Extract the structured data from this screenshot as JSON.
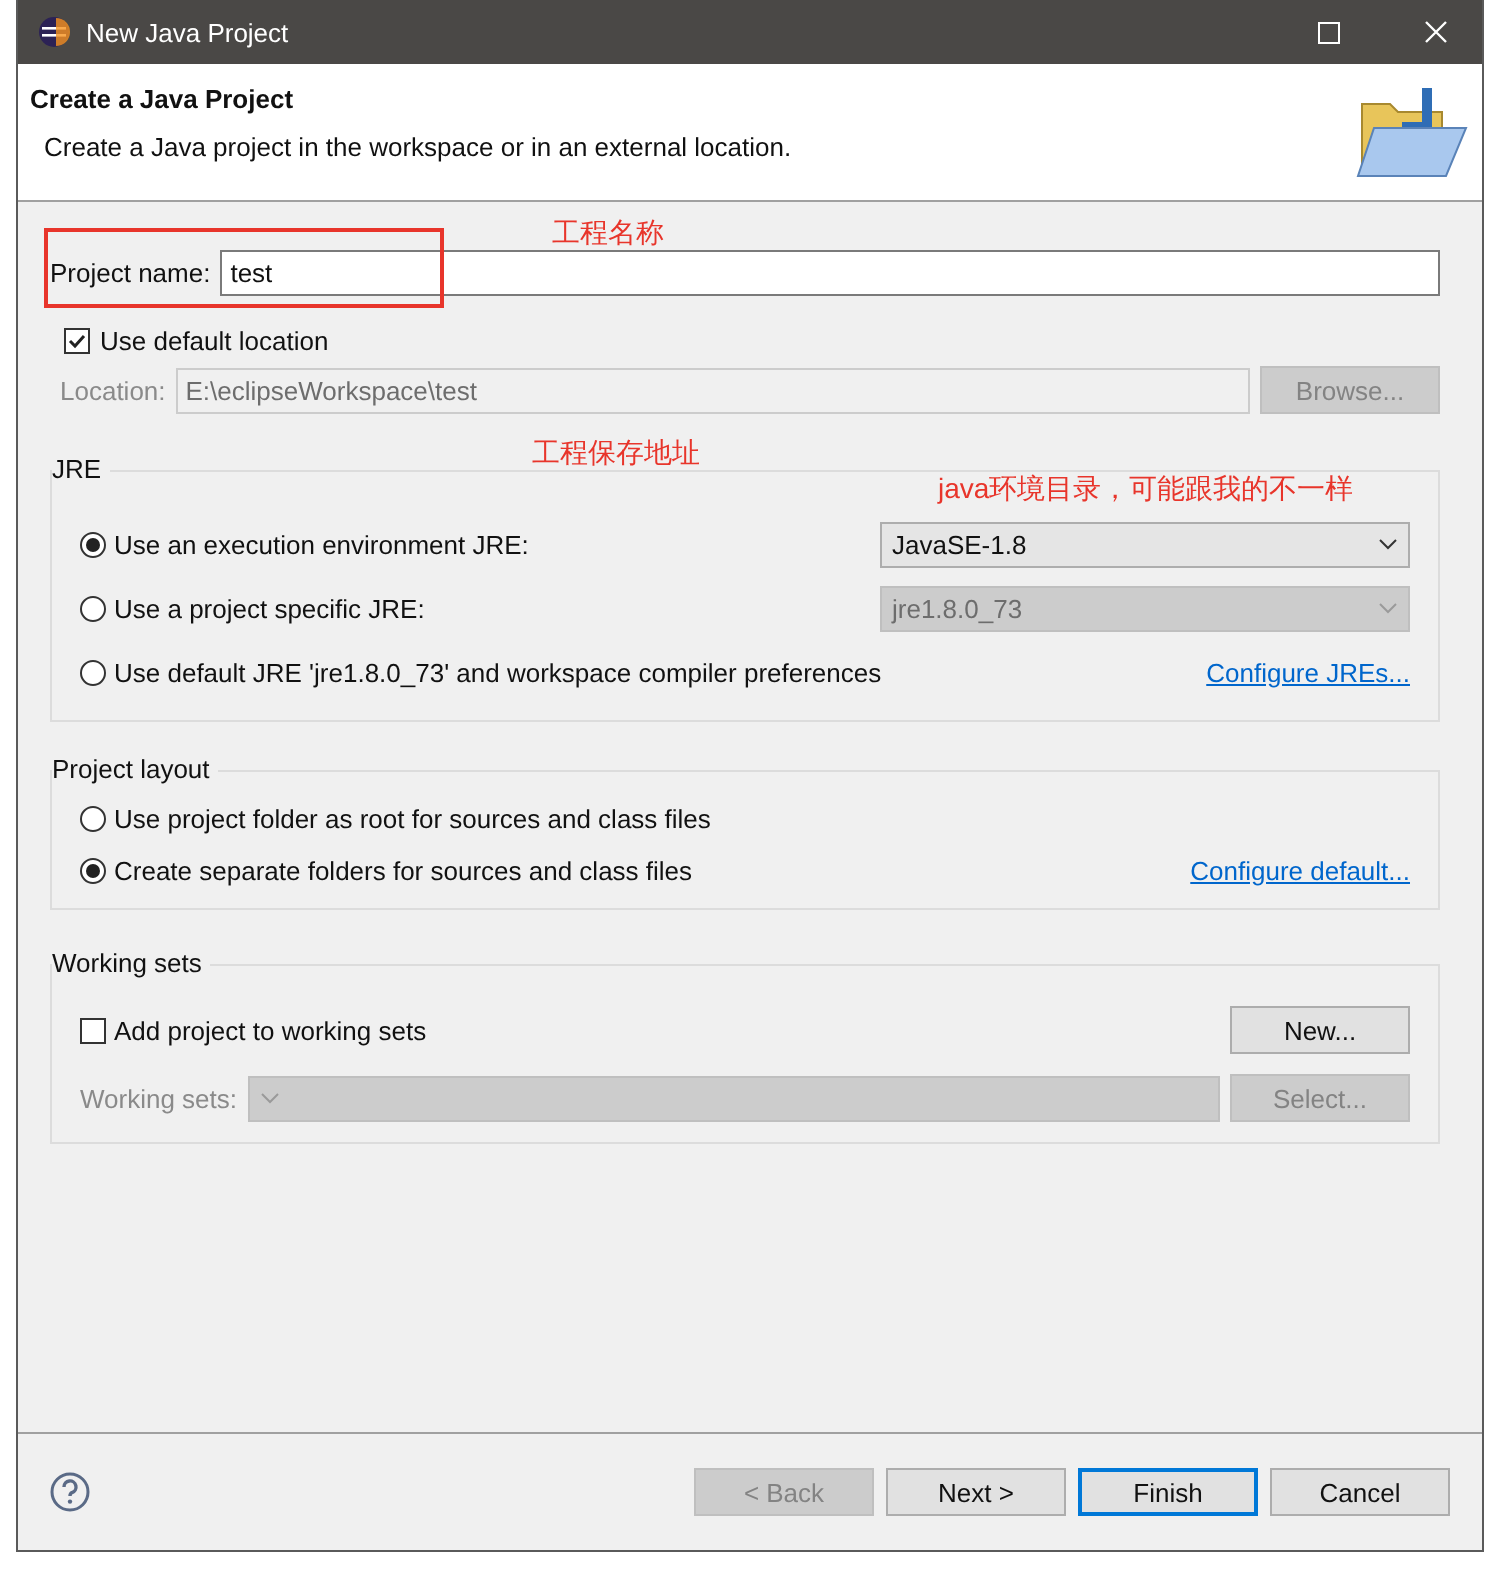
{
  "window": {
    "title": "New Java Project"
  },
  "header": {
    "title": "Create a Java Project",
    "description": "Create a Java project in the workspace or in an external location."
  },
  "project_name": {
    "label": "Project name:",
    "value": "test"
  },
  "use_default_location": {
    "label": "Use default location",
    "checked": true
  },
  "location": {
    "label": "Location:",
    "value": "E:\\eclipseWorkspace\\test",
    "disabled": true,
    "button": "Browse..."
  },
  "jre": {
    "title": "JRE",
    "options": [
      {
        "kind": "dropdown",
        "label": "Use an execution environment JRE:",
        "selected": true,
        "dropdown": "JavaSE-1.8",
        "disabled": false
      },
      {
        "kind": "dropdown",
        "label": "Use a project specific JRE:",
        "selected": false,
        "dropdown": "jre1.8.0_73",
        "disabled": true
      },
      {
        "kind": "link",
        "label": "Use default JRE 'jre1.8.0_73' and workspace compiler preferences",
        "selected": false,
        "link": "Configure JREs..."
      }
    ]
  },
  "project_layout": {
    "title": "Project layout",
    "options": [
      {
        "label": "Use project folder as root for sources and class files",
        "selected": false
      },
      {
        "label": "Create separate folders for sources and class files",
        "selected": true
      }
    ],
    "link": "Configure default..."
  },
  "working_sets": {
    "title": "Working sets",
    "checkbox": {
      "label": "Add project to working sets",
      "checked": false
    },
    "new_button": "New...",
    "field_label": "Working sets:",
    "select_button": "Select...",
    "disabled": true
  },
  "buttons": [
    {
      "label": "< Back",
      "disabled": true,
      "default": false
    },
    {
      "label": "Next >",
      "disabled": false,
      "default": false
    },
    {
      "label": "Finish",
      "disabled": false,
      "default": true
    },
    {
      "label": "Cancel",
      "disabled": false,
      "default": false
    }
  ],
  "annotations": [
    {
      "text": "工程名称"
    },
    {
      "text": "工程保存地址"
    },
    {
      "text": "java环境目录，可能跟我的不一样"
    }
  ]
}
